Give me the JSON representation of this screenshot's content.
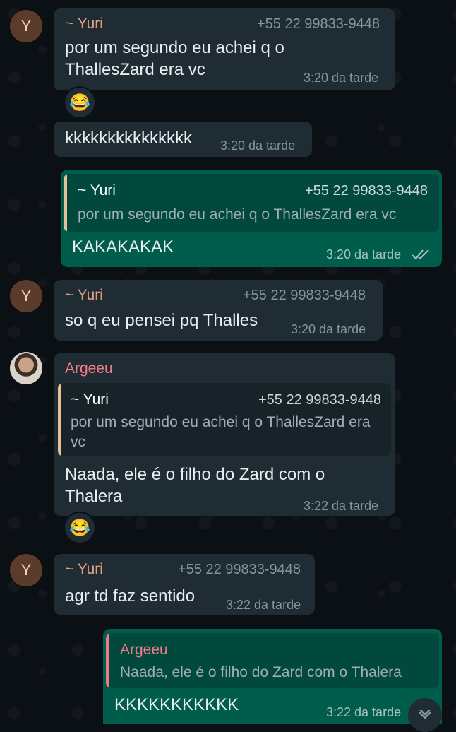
{
  "colors": {
    "yuri_name": "#e8a17e",
    "argeeu_name": "#f47a8a",
    "quote_bar_yuri": "#e8c098",
    "quote_bar_argeeu": "#f47a8a",
    "incoming_bubble": "#1f2c34",
    "outgoing_bubble": "#005c4b"
  },
  "messages": [
    {
      "avatar": "Y",
      "sender": "~ Yuri",
      "phone": "+55 22 99833-9448",
      "text": "por um segundo eu achei q o ThallesZard era vc",
      "time": "3:20 da tarde",
      "reaction": "😂"
    },
    {
      "text": "kkkkkkkkkkkkkkk",
      "time": "3:20 da tarde"
    },
    {
      "quote_sender": "~ Yuri",
      "quote_phone": "+55 22 99833-9448",
      "quote_text": "por um segundo eu achei q o ThallesZard era vc",
      "text": "KAKAKAKAK",
      "time": "3:20 da tarde"
    },
    {
      "avatar": "Y",
      "sender": "~ Yuri",
      "phone": "+55 22 99833-9448",
      "text": "so q eu pensei pq Thalles",
      "time": "3:20 da tarde"
    },
    {
      "sender": "Argeeu",
      "quote_sender": "~ Yuri",
      "quote_phone": "+55 22 99833-9448",
      "quote_text": "por um segundo eu achei q o ThallesZard era vc",
      "text": "Naada, ele é o filho do Zard com o Thalera",
      "time": "3:22 da tarde",
      "reaction": "😂"
    },
    {
      "avatar": "Y",
      "sender": "~ Yuri",
      "phone": "+55 22 99833-9448",
      "text": "agr td faz sentido",
      "time": "3:22 da tarde"
    },
    {
      "quote_sender": "Argeeu",
      "quote_text": "Naada, ele é o filho do Zard com o Thalera",
      "text": "KKKKKKKKKKK",
      "time": "3:22 da tarde"
    }
  ],
  "icons": {
    "read_ticks": "double-check-icon",
    "scroll_down": "chevron-down-icon"
  }
}
